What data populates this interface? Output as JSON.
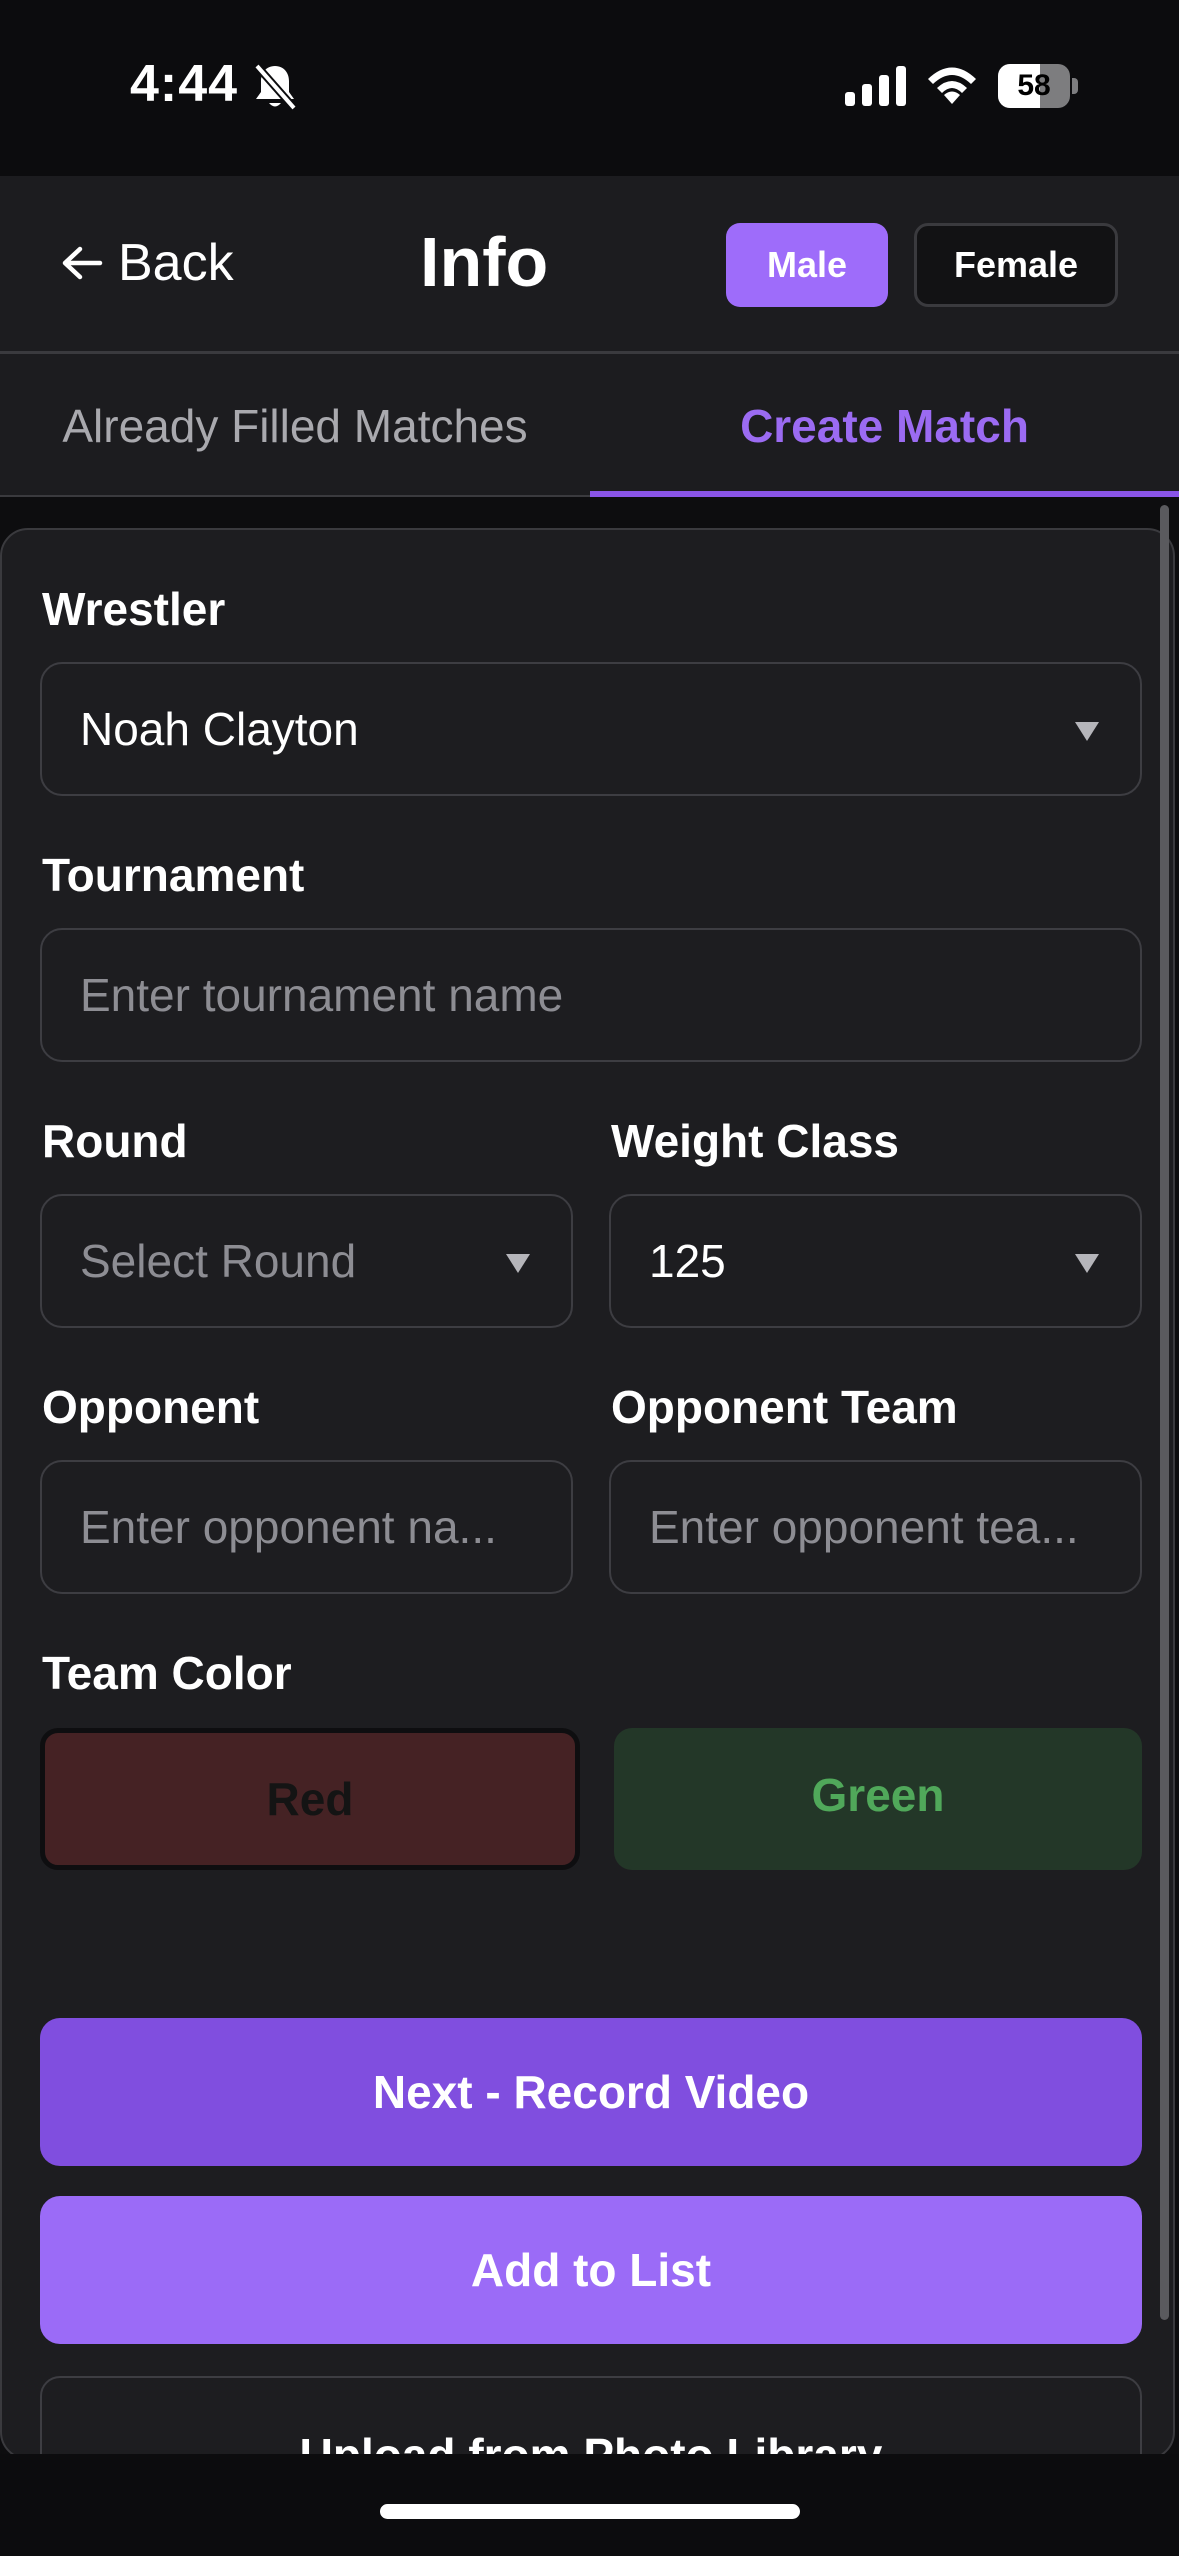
{
  "status_bar": {
    "time": "4:44",
    "battery_level": "58",
    "battery_fraction": 0.58
  },
  "header": {
    "back_label": "Back",
    "title": "Info",
    "gender_options": [
      "Male",
      "Female"
    ],
    "selected_gender": "Male"
  },
  "tabs": {
    "items": [
      "Already Filled Matches",
      "Create Match"
    ],
    "active": "Create Match"
  },
  "form": {
    "wrestler": {
      "label": "Wrestler",
      "value": "Noah Clayton"
    },
    "tournament": {
      "label": "Tournament",
      "placeholder": "Enter tournament name"
    },
    "round": {
      "label": "Round",
      "placeholder": "Select Round"
    },
    "weight_class": {
      "label": "Weight Class",
      "value": "125"
    },
    "opponent": {
      "label": "Opponent",
      "placeholder": "Enter opponent na..."
    },
    "opponent_team": {
      "label": "Opponent Team",
      "placeholder": "Enter opponent tea..."
    },
    "team_color": {
      "label": "Team Color",
      "options": [
        "Red",
        "Green"
      ],
      "selected": "Red",
      "colors": {
        "red_bg": "#452224",
        "green_bg": "#233728",
        "green_text": "#50a85a"
      }
    }
  },
  "actions": {
    "record_label": "Next - Record Video",
    "add_label": "Add to List",
    "upload_label": "Upload from Photo Library"
  },
  "theme": {
    "accent": "#9b6bf7",
    "accent_dark": "#804edf",
    "background": "#0d0d0f",
    "surface": "#1d1d20"
  }
}
